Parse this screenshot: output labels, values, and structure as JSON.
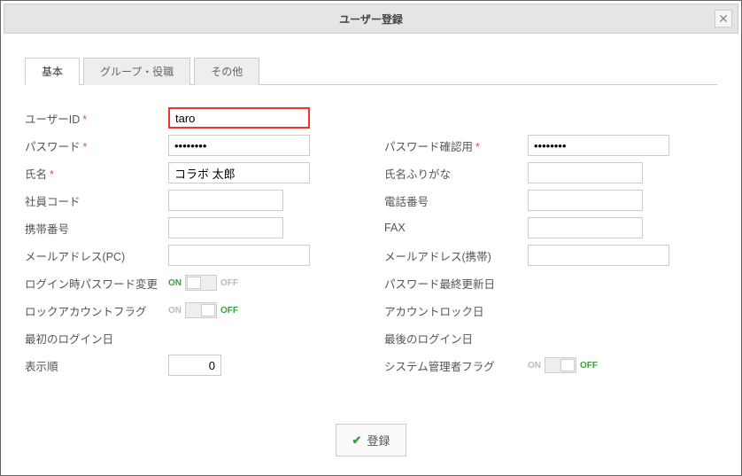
{
  "dialog": {
    "title": "ユーザー登録"
  },
  "tabs": {
    "basic": "基本",
    "group": "グループ・役職",
    "other": "その他"
  },
  "labels": {
    "user_id": "ユーザーID",
    "password": "パスワード",
    "password_confirm": "パスワード確認用",
    "name": "氏名",
    "name_kana": "氏名ふりがな",
    "emp_code": "社員コード",
    "phone": "電話番号",
    "mobile": "携帯番号",
    "fax": "FAX",
    "mail_pc": "メールアドレス(PC)",
    "mail_mobile": "メールアドレス(携帯)",
    "pw_change_on_login": "ログイン時パスワード変更",
    "pw_last_updated": "パスワード最終更新日",
    "lock_flag": "ロックアカウントフラグ",
    "account_lock_date": "アカウントロック日",
    "first_login": "最初のログイン日",
    "last_login": "最後のログイン日",
    "display_order": "表示順",
    "sysadmin_flag": "システム管理者フラグ",
    "required_mark": "*"
  },
  "values": {
    "user_id": "taro",
    "password": "••••••••",
    "password_confirm": "••••••••",
    "name": "コラボ 太郎",
    "name_kana": "",
    "emp_code": "",
    "phone": "",
    "mobile": "",
    "fax": "",
    "mail_pc": "",
    "mail_mobile": "",
    "display_order": "0"
  },
  "toggle": {
    "on": "ON",
    "off": "OFF"
  },
  "footer": {
    "submit": "登録"
  }
}
